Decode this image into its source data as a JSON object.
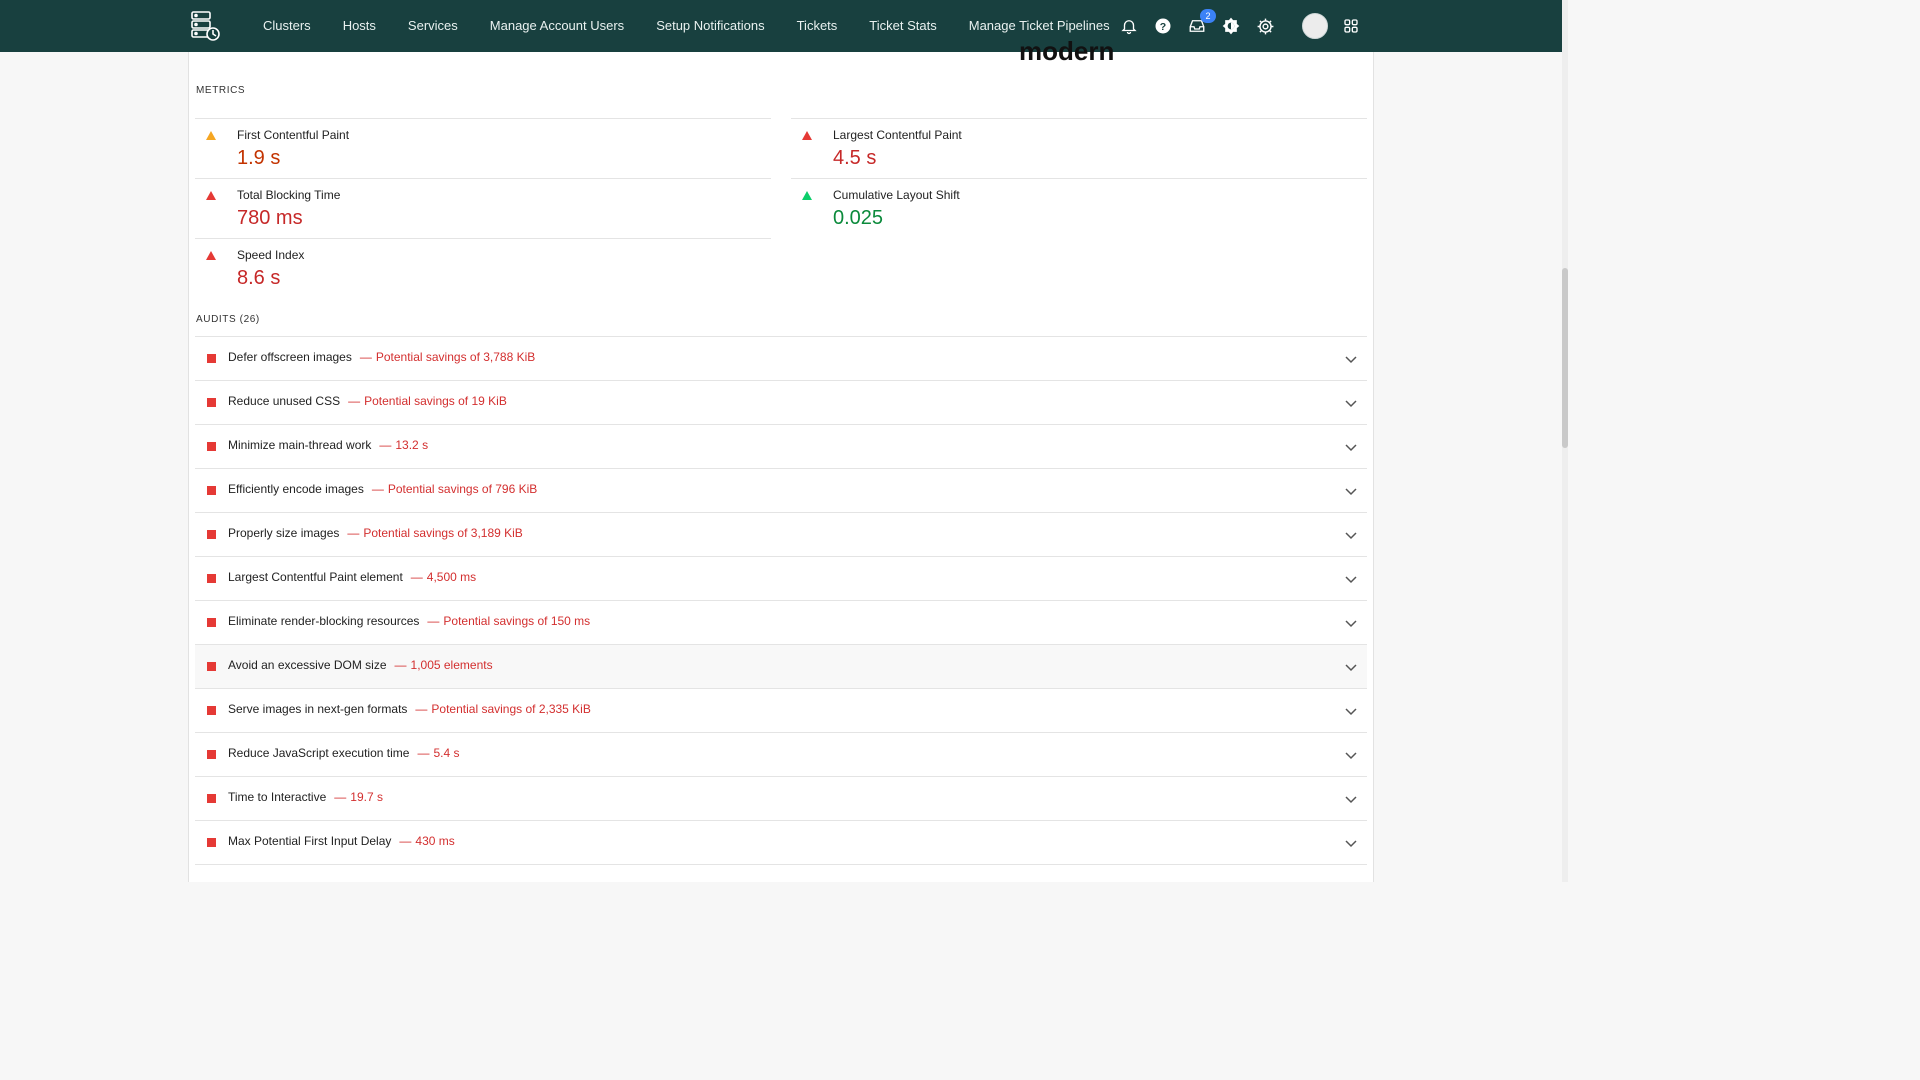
{
  "nav": {
    "links": [
      "Clusters",
      "Hosts",
      "Services",
      "Manage Account Users",
      "Setup Notifications",
      "Tickets",
      "Ticket Stats",
      "Manage Ticket Pipelines"
    ],
    "inbox_badge": "2"
  },
  "partial_heading": "modern",
  "metrics": {
    "label": "METRICS",
    "left": [
      {
        "name": "First Contentful Paint",
        "value": "1.9 s",
        "status": "orange"
      },
      {
        "name": "Total Blocking Time",
        "value": "780 ms",
        "status": "red"
      },
      {
        "name": "Speed Index",
        "value": "8.6 s",
        "status": "red"
      }
    ],
    "right": [
      {
        "name": "Largest Contentful Paint",
        "value": "4.5 s",
        "status": "red"
      },
      {
        "name": "Cumulative Layout Shift",
        "value": "0.025",
        "status": "green"
      }
    ]
  },
  "audits": {
    "label": "AUDITS (26)",
    "items": [
      {
        "title": "Defer offscreen images",
        "detail": "Potential savings of 3,788 KiB"
      },
      {
        "title": "Reduce unused CSS",
        "detail": "Potential savings of 19 KiB"
      },
      {
        "title": "Minimize main-thread work",
        "detail": "13.2 s"
      },
      {
        "title": "Efficiently encode images",
        "detail": "Potential savings of 796 KiB"
      },
      {
        "title": "Properly size images",
        "detail": "Potential savings of 3,189 KiB"
      },
      {
        "title": "Largest Contentful Paint element",
        "detail": "4,500 ms"
      },
      {
        "title": "Eliminate render-blocking resources",
        "detail": "Potential savings of 150 ms"
      },
      {
        "title": "Avoid an excessive DOM size",
        "detail": "1,005 elements"
      },
      {
        "title": "Serve images in next-gen formats",
        "detail": "Potential savings of 2,335 KiB"
      },
      {
        "title": "Reduce JavaScript execution time",
        "detail": "5.4 s"
      },
      {
        "title": "Time to Interactive",
        "detail": "19.7 s"
      },
      {
        "title": "Max Potential First Input Delay",
        "detail": "430 ms"
      }
    ]
  },
  "colors": {
    "navbar": "#18403f",
    "fail": "#e53935",
    "average": "#f5a623",
    "pass": "#0cce6b"
  }
}
